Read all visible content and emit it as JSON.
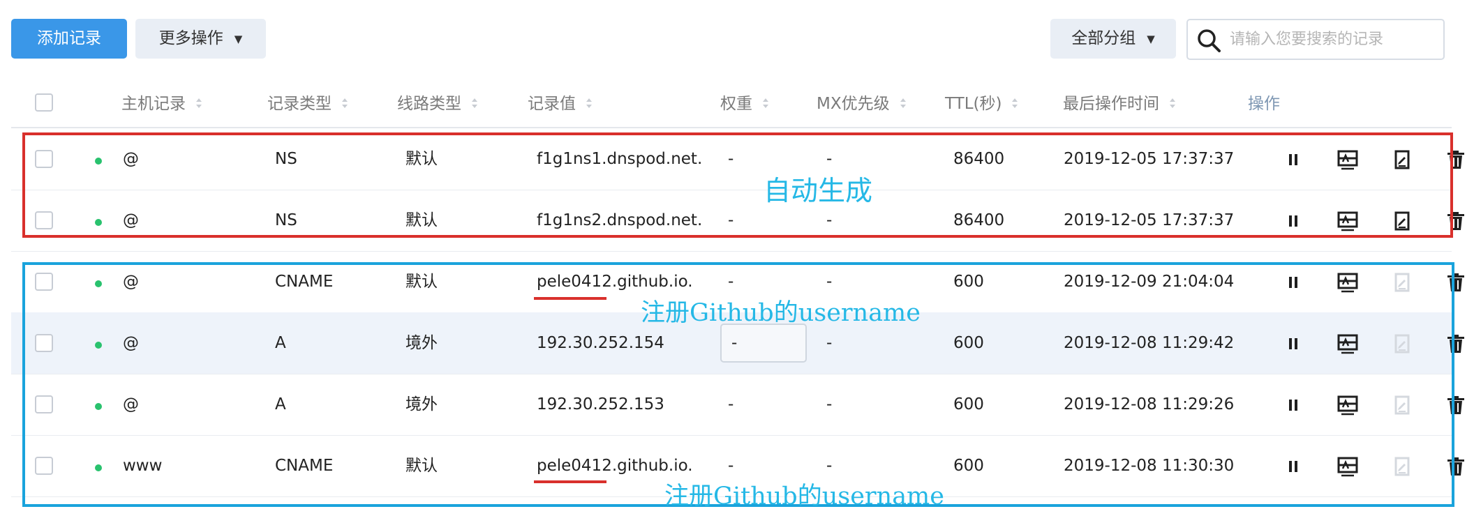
{
  "toolbar": {
    "add_label": "添加记录",
    "more_label": "更多操作",
    "group_label": "全部分组",
    "search_placeholder": "请输入您要搜索的记录"
  },
  "table": {
    "columns": [
      "主机记录",
      "记录类型",
      "线路类型",
      "记录值",
      "权重",
      "MX优先级",
      "TTL(秒)",
      "最后操作时间",
      "操作"
    ],
    "rows": [
      {
        "host": "@",
        "type": "NS",
        "line": "默认",
        "value": "f1g1ns1.dnspod.net.",
        "weight": "-",
        "mx": "-",
        "ttl": "86400",
        "time": "2019-12-05 17:37:37",
        "edit_enabled": true
      },
      {
        "host": "@",
        "type": "NS",
        "line": "默认",
        "value": "f1g1ns2.dnspod.net.",
        "weight": "-",
        "mx": "-",
        "ttl": "86400",
        "time": "2019-12-05 17:37:37",
        "edit_enabled": true
      },
      {
        "host": "@",
        "type": "CNAME",
        "line": "默认",
        "value": "pele0412.github.io.",
        "weight": "-",
        "mx": "-",
        "ttl": "600",
        "time": "2019-12-09 21:04:04",
        "edit_enabled": false
      },
      {
        "host": "@",
        "type": "A",
        "line": "境外",
        "value": "192.30.252.154",
        "weight": "-",
        "mx": "-",
        "ttl": "600",
        "time": "2019-12-08 11:29:42",
        "edit_enabled": false
      },
      {
        "host": "@",
        "type": "A",
        "line": "境外",
        "value": "192.30.252.153",
        "weight": "-",
        "mx": "-",
        "ttl": "600",
        "time": "2019-12-08 11:29:26",
        "edit_enabled": false
      },
      {
        "host": "www",
        "type": "CNAME",
        "line": "默认",
        "value": "pele0412.github.io.",
        "weight": "-",
        "mx": "-",
        "ttl": "600",
        "time": "2019-12-08 11:30:30",
        "edit_enabled": false
      }
    ]
  },
  "annotations": {
    "auto_generated": "自动生成",
    "github_username_1": "注册Github的username",
    "github_username_2": "注册Github的username"
  },
  "colors": {
    "primary": "#3a97e8",
    "status_enabled": "#29c26e",
    "annotation_red": "#d9302c",
    "annotation_blue": "#1aa3dc",
    "annotation_text": "#25b8e6"
  },
  "icons": [
    "search-icon",
    "caret-down-icon",
    "sort-icon",
    "pause-icon",
    "remark-icon",
    "edit-icon",
    "trash-icon"
  ]
}
